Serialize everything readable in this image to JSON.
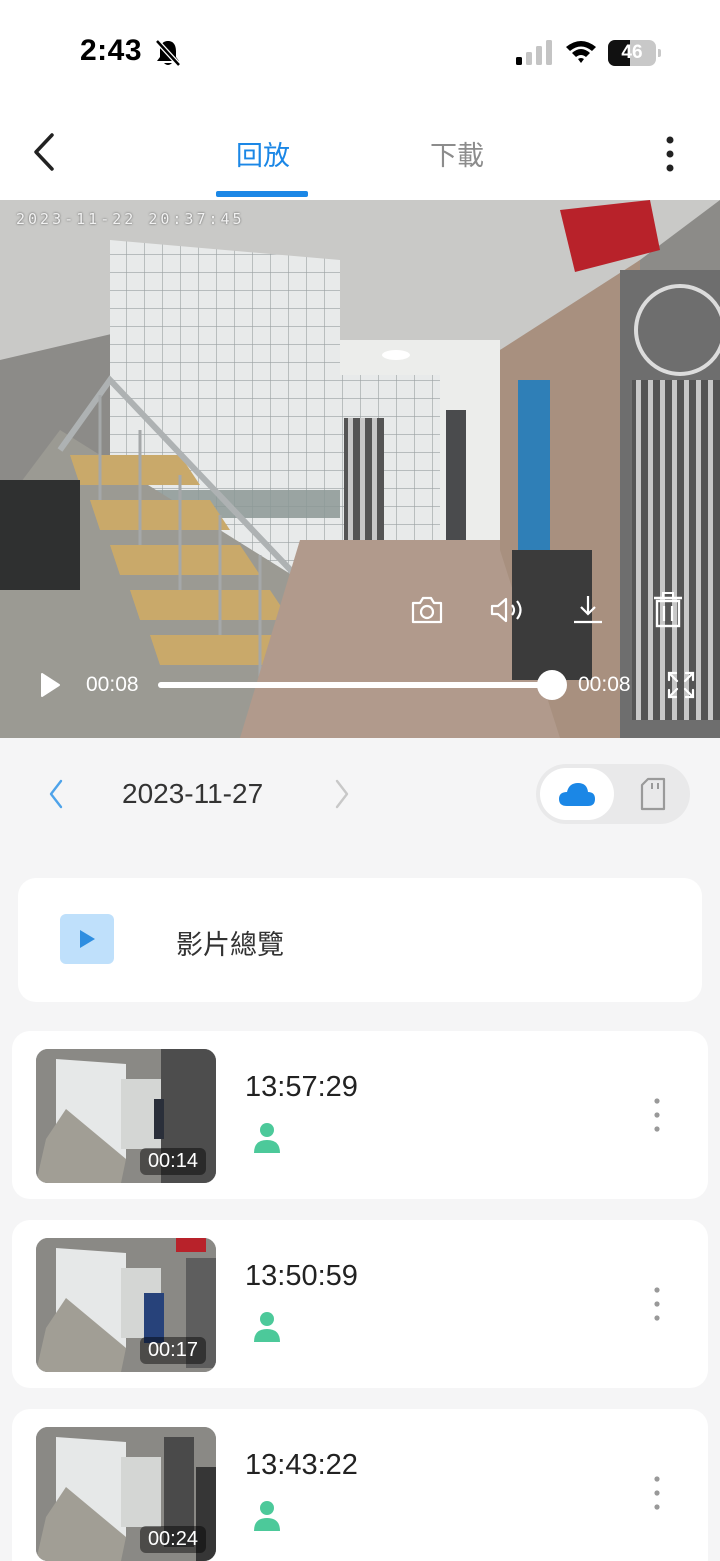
{
  "status_bar": {
    "time": "2:43",
    "battery": "46",
    "battery_level": 0.46
  },
  "header": {
    "tabs": [
      {
        "label": "回放",
        "active": true
      },
      {
        "label": "下載",
        "active": false
      }
    ]
  },
  "player": {
    "osd_timestamp": "2023-11-22 20:37:45",
    "current_time": "00:08",
    "duration": "00:08",
    "progress": 1.0
  },
  "date_nav": {
    "date": "2023-11-27",
    "storage_selected": "cloud"
  },
  "overview": {
    "label": "影片總覽"
  },
  "clips": [
    {
      "time": "13:57:29",
      "duration": "00:14",
      "event": "person"
    },
    {
      "time": "13:50:59",
      "duration": "00:17",
      "event": "person"
    },
    {
      "time": "13:43:22",
      "duration": "00:24",
      "event": "person"
    }
  ],
  "colors": {
    "accent": "#1b87e6",
    "person_event": "#4cc99a",
    "overview_icon_bg": "#bfe0fb"
  }
}
